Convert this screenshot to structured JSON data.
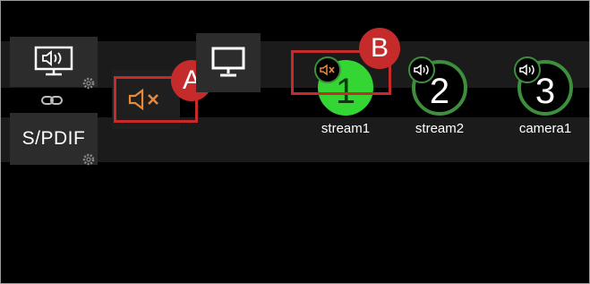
{
  "screen": {
    "spdif_label": "S/PDIF",
    "accent_green": "#33d633",
    "ring_green": "#3d8f3d",
    "callout_red": "#c62b2b",
    "muted_orange": "#e8883a"
  },
  "sources": [
    {
      "number": "1",
      "name": "stream1",
      "state": "active",
      "audio": "muted"
    },
    {
      "number": "2",
      "name": "stream2",
      "state": "inactive",
      "audio": "on"
    },
    {
      "number": "3",
      "name": "camera1",
      "state": "inactive",
      "audio": "on"
    }
  ],
  "callouts": {
    "a": "A",
    "b": "B"
  },
  "icons": {
    "audio_output": "speaker-monitor-icon",
    "link": "link-icon",
    "settings": "gear-icon",
    "mute": "speaker-muted-icon",
    "display": "monitor-icon",
    "audio_on": "speaker-on-icon"
  }
}
